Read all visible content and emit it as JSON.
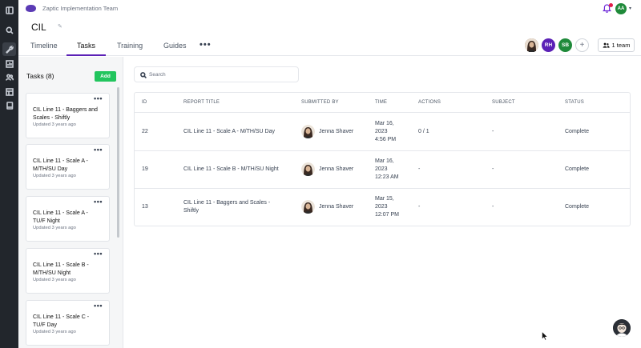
{
  "app": {
    "org_name": "Zaptic Implementation Team",
    "user_initials": "AA",
    "brand_color": "#5b3bb5"
  },
  "rail": {
    "icons": [
      "sidebar-toggle-icon",
      "search-icon",
      "wrench-icon",
      "chart-icon",
      "users-icon",
      "table-icon",
      "book-icon"
    ]
  },
  "project": {
    "title": "CIL",
    "tabs": [
      {
        "label": "Timeline"
      },
      {
        "label": "Tasks"
      },
      {
        "label": "Training"
      },
      {
        "label": "Guides"
      }
    ],
    "team_avatars": [
      {
        "initials": "",
        "color": "#6b4f3a"
      },
      {
        "initials": "RH",
        "color": "#5b21b6"
      },
      {
        "initials": "SB",
        "color": "#1f8a3a"
      }
    ],
    "team_button": "1 team"
  },
  "tasks": {
    "title": "Tasks (8)",
    "add_label": "Add",
    "items": [
      {
        "name": "CIL Line 11 - Baggers and Scales - Shiftly",
        "updated": "Updated 3 years ago"
      },
      {
        "name": "CIL Line 11 - Scale A - M/TH/SU Day",
        "updated": "Updated 3 years ago"
      },
      {
        "name": "CIL Line 11 - Scale A - TU/F Night",
        "updated": "Updated 3 years ago"
      },
      {
        "name": "CIL Line 11 - Scale B - M/TH/SU Night",
        "updated": "Updated 3 years ago"
      },
      {
        "name": "CIL Line 11 - Scale C - TU/F Day",
        "updated": "Updated 3 years ago"
      }
    ]
  },
  "search": {
    "placeholder": "Search"
  },
  "table": {
    "headers": [
      "ID",
      "REPORT TITLE",
      "SUBMITTED BY",
      "TIME",
      "ACTIONS",
      "SUBJECT",
      "STATUS"
    ],
    "rows": [
      {
        "id": "22",
        "title": "CIL Line 11 - Scale A - M/TH/SU Day",
        "submitted_by": "Jenna Shaver",
        "time": [
          "Mar 16,",
          "2023",
          "4:56 PM"
        ],
        "actions": "0 / 1",
        "subject": "-",
        "status": "Complete"
      },
      {
        "id": "19",
        "title": "CIL Line 11 - Scale B - M/TH/SU Night",
        "submitted_by": "Jenna Shaver",
        "time": [
          "Mar 16,",
          "2023",
          "12:23 AM"
        ],
        "actions": "-",
        "subject": "-",
        "status": "Complete"
      },
      {
        "id": "13",
        "title": "CIL Line 11 - Baggers and Scales - Shiftly",
        "submitted_by": "Jenna Shaver",
        "time": [
          "Mar 15,",
          "2023",
          "12:07 PM"
        ],
        "actions": "-",
        "subject": "-",
        "status": "Complete"
      }
    ]
  }
}
